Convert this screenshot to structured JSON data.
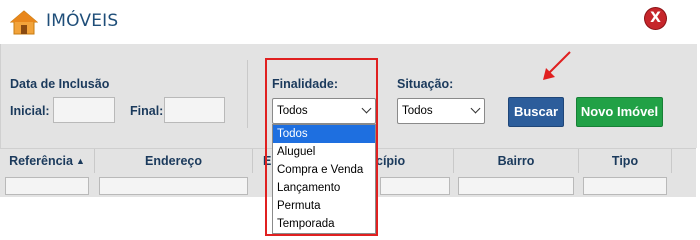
{
  "window": {
    "title": "IMÓVEIS",
    "close_label": "X"
  },
  "filters": {
    "data_inclusao_label": "Data de Inclusão",
    "inicial_label": "Inicial:",
    "inicial_value": "",
    "final_label": "Final:",
    "final_value": "",
    "finalidade_label": "Finalidade:",
    "finalidade_selected": "Todos",
    "finalidade_options": [
      "Todos",
      "Aluguel",
      "Compra e Venda",
      "Lançamento",
      "Permuta",
      "Temporada"
    ],
    "situacao_label": "Situação:",
    "situacao_selected": "Todos"
  },
  "buttons": {
    "buscar": "Buscar",
    "novo_imovel": "Novo Imóvel"
  },
  "table": {
    "columns": [
      "Referência",
      "Endereço",
      "Es",
      "cípio",
      "Bairro",
      "Tipo"
    ]
  },
  "colors": {
    "accent_blue": "#2c5d9b",
    "accent_green": "#21a146",
    "close_red": "#c6262b",
    "annotation_red": "#e02020",
    "option_highlight": "#1e6fe0"
  }
}
